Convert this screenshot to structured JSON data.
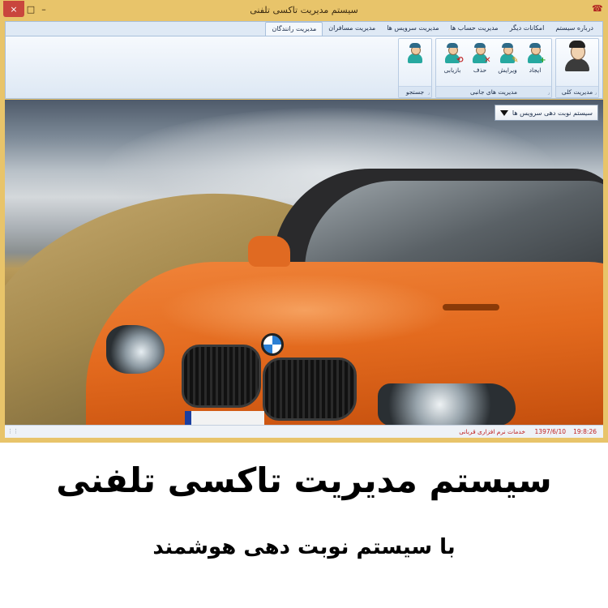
{
  "window": {
    "title": "سیستم مدیریت تاکسی تلفنی",
    "close_glyph": "×",
    "maximize_glyph": "□",
    "minimize_glyph": "–",
    "app_icon_glyph": "☎"
  },
  "ribbon": {
    "tabs": [
      {
        "label": "مدیریت رانندگان"
      },
      {
        "label": "مدیریت مسافران"
      },
      {
        "label": "مدیریت سرویس ها"
      },
      {
        "label": "مدیریت حساب ها"
      },
      {
        "label": "امکانات دیگر"
      },
      {
        "label": "درباره سیستم"
      }
    ],
    "groups": {
      "general": {
        "label": "مدیریت کلی"
      },
      "substitute": {
        "label": "مدیریت های جانبی",
        "buttons": [
          {
            "label": "ایجاد",
            "badge": "+"
          },
          {
            "label": "ویرایش",
            "badge": "✎"
          },
          {
            "label": "حذف",
            "badge": "✕"
          },
          {
            "label": "بازیابی",
            "badge": "⟲"
          }
        ]
      },
      "search": {
        "label": "جستجو"
      }
    }
  },
  "content": {
    "dropdown": {
      "selected": "سیستم نوبت دهی سرویس ها"
    }
  },
  "statusbar": {
    "time": "19:8:26",
    "date": "1397/6/10",
    "company": "خدمات نرم افزاری قربانی"
  },
  "banner": {
    "headline": "سیستم مدیریت تاکسی تلفنی",
    "subheadline": "با سیستم نوبت دهی هوشمند"
  },
  "colors": {
    "frame": "#e8c46a",
    "close": "#c9463d",
    "status_text": "#c02020",
    "ribbon_bg": "#dfe9f5"
  }
}
